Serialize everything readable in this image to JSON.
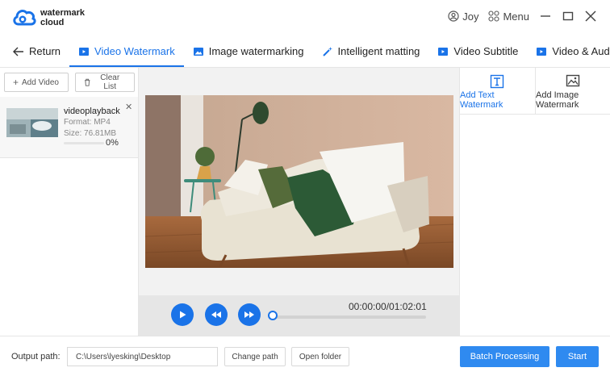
{
  "app": {
    "logo_text": "watermark\ncloud",
    "logo_line1": "watermark",
    "logo_line2": "cloud"
  },
  "window": {
    "user_name": "Joy",
    "menu_label": "Menu"
  },
  "tabs": [
    {
      "label": "Return",
      "icon": "arrow-left-icon"
    },
    {
      "label": "Video Watermark",
      "icon": "video-icon",
      "active": true
    },
    {
      "label": "Image watermarking",
      "icon": "image-icon"
    },
    {
      "label": "Intelligent matting",
      "icon": "magic-wand-icon"
    },
    {
      "label": "Video Subtitle",
      "icon": "video-icon"
    },
    {
      "label": "Video & Audio Sepa",
      "icon": "video-icon"
    }
  ],
  "file_list": {
    "add_label": "Add Video",
    "clear_label": "Clear List",
    "items": [
      {
        "name": "videoplayback",
        "format": "Format:  MP4",
        "size": "Size:  76.81MB",
        "progress_text": "0%",
        "progress": 0
      }
    ]
  },
  "player": {
    "timecode": "00:00:00/01:02:01",
    "position": 0
  },
  "watermark_tabs": {
    "text_label": "Add Text Watermark",
    "image_label": "Add Image Watermark"
  },
  "output": {
    "label": "Output path:",
    "path": "C:\\Users\\lyesking\\Desktop",
    "change_label": "Change path",
    "open_label": "Open folder",
    "batch_label": "Batch Processing",
    "start_label": "Start"
  },
  "colors": {
    "accent": "#1a73e8",
    "button": "#2f8af0",
    "panel": "#f2f2f2"
  }
}
